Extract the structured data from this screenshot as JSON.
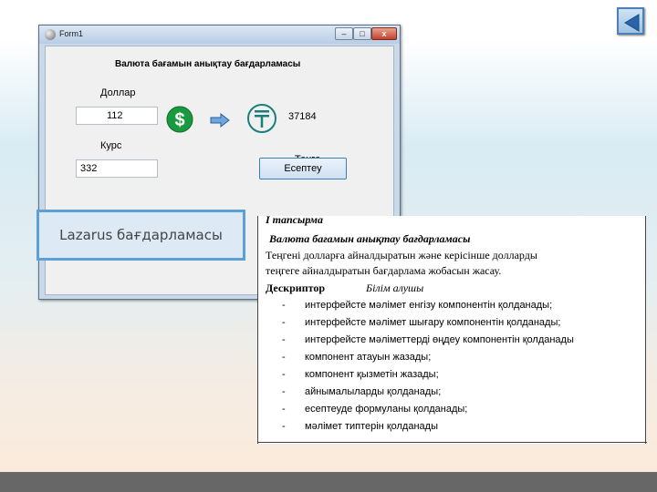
{
  "form": {
    "title": "Form1",
    "minimize": "–",
    "maximize": "□",
    "close": "x",
    "heading": "Валюта бағамын анықтау бағдарламасы",
    "dollar_label": "Доллар",
    "dollar_value": "112",
    "kurs_label": "Курс",
    "kurs_value": "332",
    "result_value": "37184",
    "tenge_label": "Теңге",
    "calc_button": "Есептеу",
    "icons": [
      "dollar-coin-icon",
      "right-arrow-icon",
      "tenge-icon"
    ]
  },
  "caption": "Lazarus бағдарламасы",
  "task": {
    "heading": "I тапсырма",
    "title": "Валюта бағамын анықтау бағдарламасы",
    "paragraph_1": "Теңгені долларға айналдыратын және керісінше долларды",
    "paragraph_2": "теңгеге айналдыратын бағдарлама жобасын жасау.",
    "descriptor_label": "Дескриптор",
    "learner_label": "Білім алушы",
    "items": [
      "интерфейсте мәлімет енгізу компонентін қолданады;",
      "интерфейсте мәлімет шығару компонентін қолданады;",
      "интерфейсте мәліметтерді өңдеу компонентін қолданады",
      "компонент атауын жазады;",
      "компонент қызметін жазады;",
      "айнымалыларды қолданады;",
      "есептеуде формуланы қолданады;",
      "мәлімет типтерін қолданады"
    ]
  },
  "colors": {
    "accent": "#5ba0d6",
    "footer": "#676767",
    "dollar_green": "#1a9a3e",
    "tenge_teal": "#1a7f7a"
  }
}
